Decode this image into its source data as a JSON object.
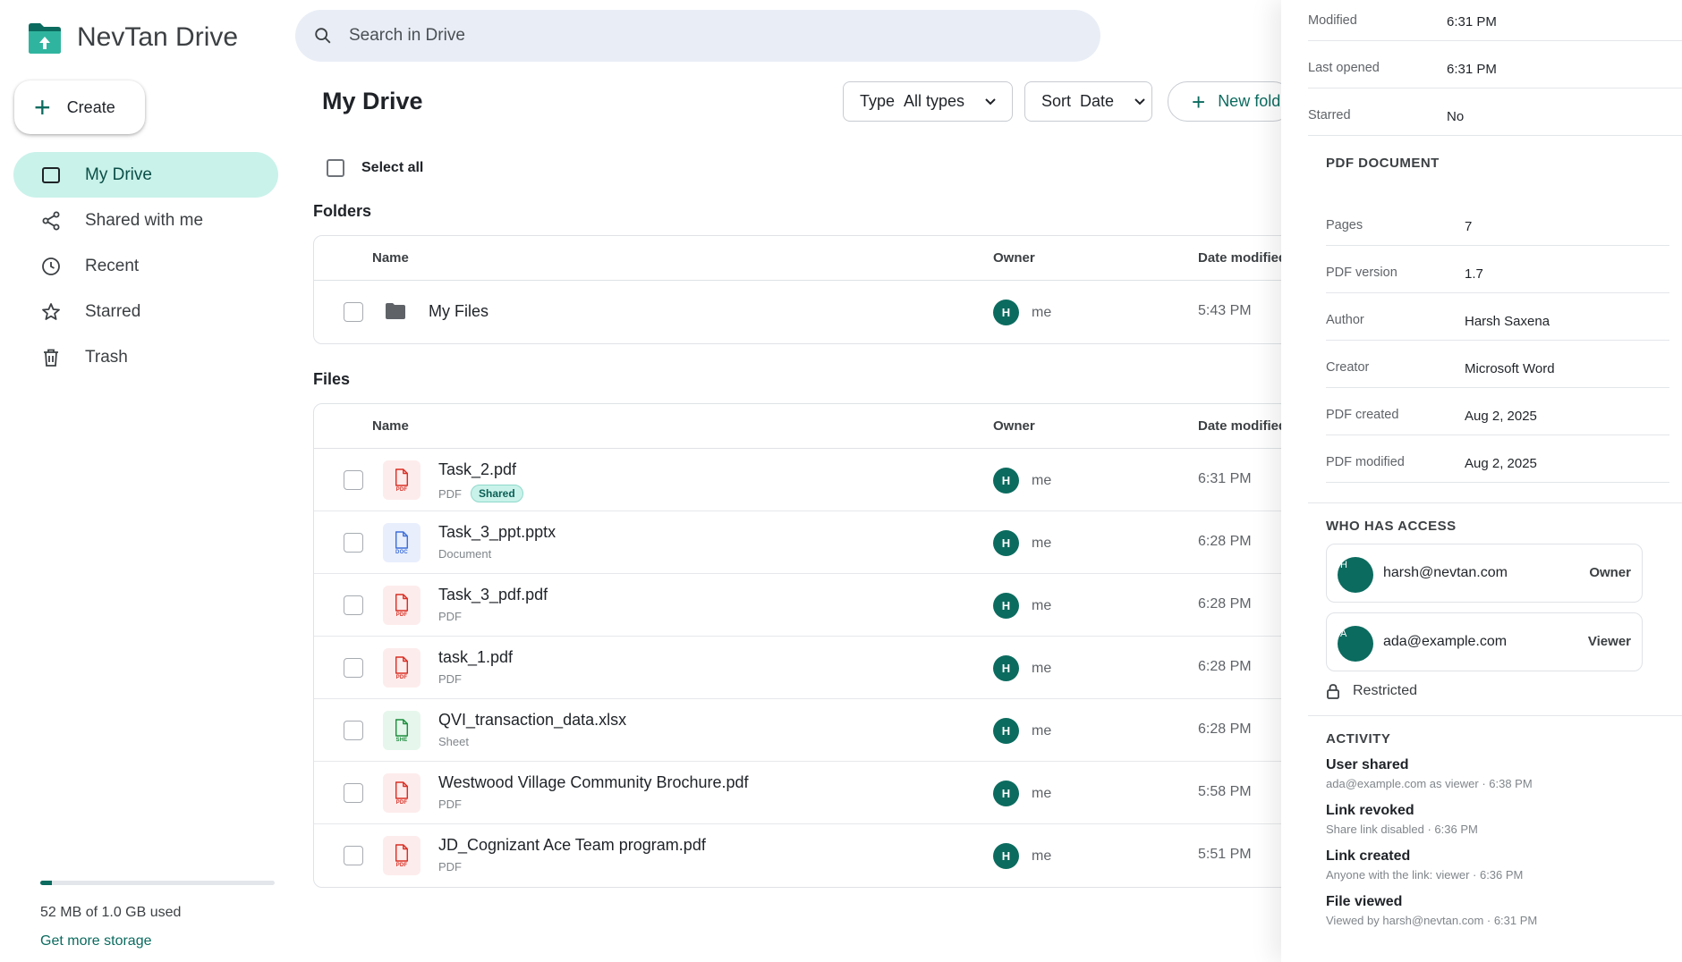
{
  "app": {
    "name": "NevTan Drive"
  },
  "sidebar": {
    "create_label": "Create",
    "items": [
      {
        "label": "My Drive",
        "icon": "drive-icon",
        "active": true
      },
      {
        "label": "Shared with me",
        "icon": "share-icon",
        "active": false
      },
      {
        "label": "Recent",
        "icon": "clock-icon",
        "active": false
      },
      {
        "label": "Starred",
        "icon": "star-icon",
        "active": false
      },
      {
        "label": "Trash",
        "icon": "trash-icon",
        "active": false
      }
    ],
    "storage": {
      "used_text": "52 MB of 1.0 GB used",
      "used_fraction": 0.05,
      "link": "Get more storage"
    }
  },
  "search": {
    "placeholder": "Search in Drive"
  },
  "main": {
    "title": "My Drive",
    "filters": {
      "type_label": "Type",
      "type_value": "All types",
      "sort_label": "Sort",
      "sort_value": "Date",
      "new_folder_label": "New folder"
    },
    "select_all": "Select all",
    "folders_label": "Folders",
    "files_label": "Files",
    "columns": {
      "name": "Name",
      "owner": "Owner",
      "date": "Date modified"
    },
    "folders": [
      {
        "name": "My Files",
        "owner": "me",
        "owner_initial": "H",
        "date": "5:43 PM"
      }
    ],
    "files": [
      {
        "name": "Task_2.pdf",
        "kind": "PDF",
        "tag": "PDF",
        "badge": "Shared",
        "owner": "me",
        "owner_initial": "H",
        "date": "6:31 PM",
        "icon": "pdf"
      },
      {
        "name": "Task_3_ppt.pptx",
        "kind": "Document",
        "tag": "DOC",
        "badge": "",
        "owner": "me",
        "owner_initial": "H",
        "date": "6:28 PM",
        "icon": "doc"
      },
      {
        "name": "Task_3_pdf.pdf",
        "kind": "PDF",
        "tag": "PDF",
        "badge": "",
        "owner": "me",
        "owner_initial": "H",
        "date": "6:28 PM",
        "icon": "pdf"
      },
      {
        "name": "task_1.pdf",
        "kind": "PDF",
        "tag": "PDF",
        "badge": "",
        "owner": "me",
        "owner_initial": "H",
        "date": "6:28 PM",
        "icon": "pdf"
      },
      {
        "name": "QVI_transaction_data.xlsx",
        "kind": "Sheet",
        "tag": "SHE",
        "badge": "",
        "owner": "me",
        "owner_initial": "H",
        "date": "6:28 PM",
        "icon": "sheet"
      },
      {
        "name": "Westwood Village Community Brochure.pdf",
        "kind": "PDF",
        "tag": "PDF",
        "badge": "",
        "owner": "me",
        "owner_initial": "H",
        "date": "5:58 PM",
        "icon": "pdf"
      },
      {
        "name": "JD_Cognizant Ace Team program.pdf",
        "kind": "PDF",
        "tag": "PDF",
        "badge": "",
        "owner": "me",
        "owner_initial": "H",
        "date": "5:51 PM",
        "icon": "pdf"
      }
    ]
  },
  "details": {
    "general": [
      {
        "key": "Modified",
        "value": "6:31 PM"
      },
      {
        "key": "Last opened",
        "value": "6:31 PM"
      },
      {
        "key": "Starred",
        "value": "No"
      }
    ],
    "pdf_heading": "PDF DOCUMENT",
    "pdf": [
      {
        "key": "Pages",
        "value": "7"
      },
      {
        "key": "PDF version",
        "value": "1.7"
      },
      {
        "key": "Author",
        "value": "Harsh Saxena"
      },
      {
        "key": "Creator",
        "value": "Microsoft Word"
      },
      {
        "key": "PDF created",
        "value": "Aug 2, 2025"
      },
      {
        "key": "PDF modified",
        "value": "Aug 2, 2025"
      }
    ],
    "access_heading": "WHO HAS ACCESS",
    "access": [
      {
        "initial": "H",
        "email": "harsh@nevtan.com",
        "role": "Owner"
      },
      {
        "initial": "A",
        "email": "ada@example.com",
        "role": "Viewer"
      }
    ],
    "restricted": "Restricted",
    "activity_heading": "ACTIVITY",
    "activity": [
      {
        "title": "User shared",
        "desc": "ada@example.com as viewer · 6:38 PM"
      },
      {
        "title": "Link revoked",
        "desc": "Share link disabled · 6:36 PM"
      },
      {
        "title": "Link created",
        "desc": "Anyone with the link: viewer · 6:36 PM"
      },
      {
        "title": "File viewed",
        "desc": "Viewed by harsh@nevtan.com · 6:31 PM"
      }
    ]
  }
}
